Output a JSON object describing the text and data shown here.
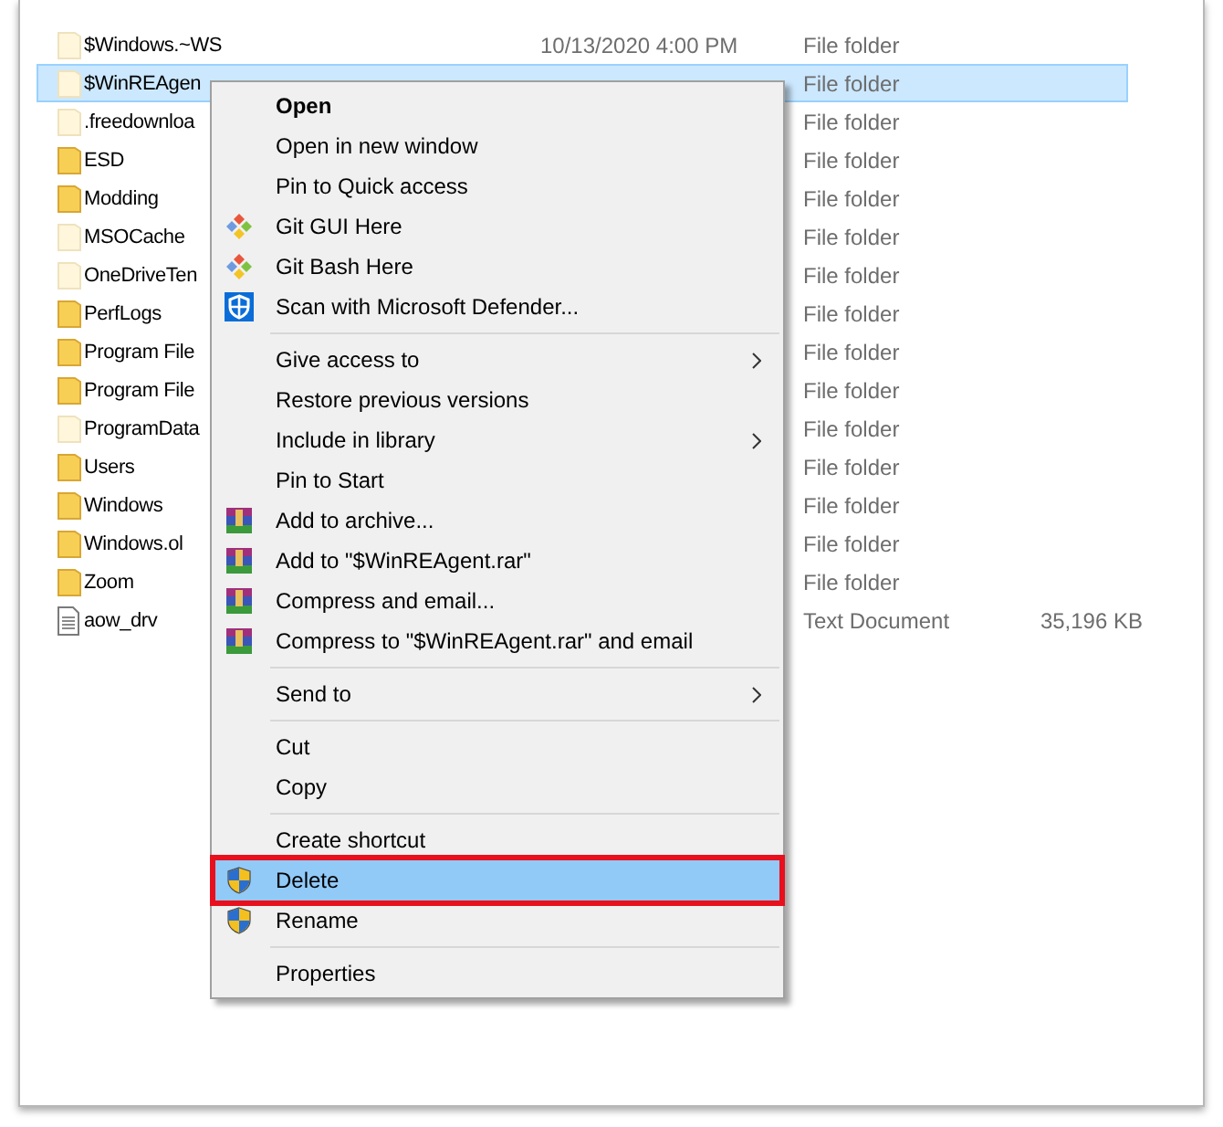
{
  "files": [
    {
      "name": "$Windows.~WS",
      "kind": "folder",
      "hidden": true,
      "selected": false,
      "date": "10/13/2020 4:00 PM",
      "type": "File folder"
    },
    {
      "name": "$WinREAgen",
      "kind": "folder",
      "hidden": true,
      "selected": true,
      "type": "File folder"
    },
    {
      "name": ".freedownloa",
      "kind": "folder",
      "hidden": true,
      "selected": false,
      "type": "File folder"
    },
    {
      "name": "ESD",
      "kind": "folder",
      "hidden": false,
      "selected": false,
      "type": "File folder"
    },
    {
      "name": "Modding",
      "kind": "folder",
      "hidden": false,
      "selected": false,
      "type": "File folder"
    },
    {
      "name": "MSOCache",
      "kind": "folder",
      "hidden": true,
      "selected": false,
      "type": "File folder"
    },
    {
      "name": "OneDriveTen",
      "kind": "folder",
      "hidden": true,
      "selected": false,
      "type": "File folder"
    },
    {
      "name": "PerfLogs",
      "kind": "folder",
      "hidden": false,
      "selected": false,
      "type": "File folder"
    },
    {
      "name": "Program File",
      "kind": "folder",
      "hidden": false,
      "selected": false,
      "type": "File folder"
    },
    {
      "name": "Program File",
      "kind": "folder",
      "hidden": false,
      "selected": false,
      "type": "File folder"
    },
    {
      "name": "ProgramData",
      "kind": "folder",
      "hidden": true,
      "selected": false,
      "type": "File folder"
    },
    {
      "name": "Users",
      "kind": "folder",
      "hidden": false,
      "selected": false,
      "type": "File folder"
    },
    {
      "name": "Windows",
      "kind": "folder",
      "hidden": false,
      "selected": false,
      "type": "File folder"
    },
    {
      "name": "Windows.ol",
      "kind": "folder",
      "hidden": false,
      "selected": false,
      "type": "File folder"
    },
    {
      "name": "Zoom",
      "kind": "folder",
      "hidden": false,
      "selected": false,
      "type": "File folder"
    },
    {
      "name": "aow_drv",
      "kind": "file",
      "selected": false,
      "type": "Text Document",
      "size": "35,196 KB"
    }
  ],
  "context_menu": {
    "groups": [
      [
        {
          "label": "Open",
          "kind": "default",
          "submenu": false,
          "selected": false
        },
        {
          "label": "Open in new window",
          "kind": "plain",
          "submenu": false,
          "selected": false
        },
        {
          "label": "Pin to Quick access",
          "kind": "plain",
          "submenu": false,
          "selected": false
        },
        {
          "label": "Git GUI Here",
          "kind": "git",
          "submenu": false,
          "selected": false
        },
        {
          "label": "Git Bash Here",
          "kind": "git",
          "submenu": false,
          "selected": false
        },
        {
          "label": "Scan with Microsoft Defender...",
          "kind": "defender",
          "submenu": false,
          "selected": false
        }
      ],
      [
        {
          "label": "Give access to",
          "kind": "plain",
          "submenu": true,
          "selected": false
        },
        {
          "label": "Restore previous versions",
          "kind": "plain",
          "submenu": false,
          "selected": false
        },
        {
          "label": "Include in library",
          "kind": "plain",
          "submenu": true,
          "selected": false
        },
        {
          "label": "Pin to Start",
          "kind": "plain",
          "submenu": false,
          "selected": false
        },
        {
          "label": "Add to archive...",
          "kind": "archive",
          "submenu": false,
          "selected": false
        },
        {
          "label": "Add to \"$WinREAgent.rar\"",
          "kind": "archive",
          "submenu": false,
          "selected": false
        },
        {
          "label": "Compress and email...",
          "kind": "archive",
          "submenu": false,
          "selected": false
        },
        {
          "label": "Compress to \"$WinREAgent.rar\" and email",
          "kind": "archive",
          "submenu": false,
          "selected": false
        }
      ],
      [
        {
          "label": "Send to",
          "kind": "plain",
          "submenu": true,
          "selected": false
        }
      ],
      [
        {
          "label": "Cut",
          "kind": "plain",
          "submenu": false,
          "selected": false
        },
        {
          "label": "Copy",
          "kind": "plain",
          "submenu": false,
          "selected": false
        }
      ],
      [
        {
          "label": "Create shortcut",
          "kind": "plain",
          "submenu": false,
          "selected": false
        },
        {
          "label": "Delete",
          "kind": "uac",
          "submenu": false,
          "selected": true
        },
        {
          "label": "Rename",
          "kind": "uac",
          "submenu": false,
          "selected": false
        }
      ],
      [
        {
          "label": "Properties",
          "kind": "plain",
          "submenu": false,
          "selected": false
        }
      ]
    ]
  }
}
